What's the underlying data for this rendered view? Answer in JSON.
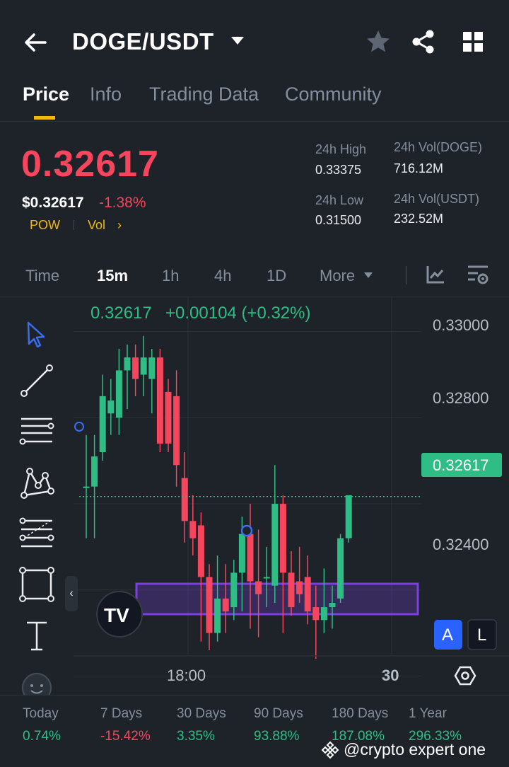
{
  "header": {
    "pair": "DOGE/USDT"
  },
  "tabs": [
    "Price",
    "Info",
    "Trading Data",
    "Community"
  ],
  "price": {
    "last": "0.32617",
    "usd": "$0.32617",
    "change_pct": "-1.38%",
    "tags": [
      "POW",
      "Vol"
    ],
    "stats": {
      "high_label": "24h High",
      "high_value": "0.33375",
      "low_label": "24h Low",
      "low_value": "0.31500",
      "vol_doge_label": "24h Vol(DOGE)",
      "vol_doge_value": "716.12M",
      "vol_usdt_label": "24h Vol(USDT)",
      "vol_usdt_value": "232.52M"
    }
  },
  "timeframes": {
    "items": [
      "Time",
      "15m",
      "1h",
      "4h",
      "1D",
      "More"
    ],
    "selected": "15m"
  },
  "chart": {
    "info_price": "0.32617",
    "info_change": "+0.00104 (+0.32%)",
    "current_price_label": "0.32617",
    "y_ticks": [
      "0.33000",
      "0.32800",
      "0.32400"
    ],
    "x_ticks": [
      "18:00",
      "30"
    ],
    "scale_buttons": [
      "A",
      "L"
    ],
    "logo_text": "TV",
    "colors": {
      "up": "#2ebd85",
      "down": "#f6465d",
      "box": "#7b3fe4"
    }
  },
  "chart_data": {
    "type": "candlestick",
    "y_range": [
      0.3225,
      0.3308
    ],
    "candles": [
      {
        "o": 0.3264,
        "h": 0.3276,
        "l": 0.3252,
        "c": 0.3264
      },
      {
        "o": 0.3264,
        "h": 0.3276,
        "l": 0.3252,
        "c": 0.3271
      },
      {
        "o": 0.3272,
        "h": 0.329,
        "l": 0.327,
        "c": 0.3285
      },
      {
        "o": 0.3281,
        "h": 0.3289,
        "l": 0.3276,
        "c": 0.3284
      },
      {
        "o": 0.328,
        "h": 0.3296,
        "l": 0.3276,
        "c": 0.3291
      },
      {
        "o": 0.3291,
        "h": 0.3297,
        "l": 0.3282,
        "c": 0.3294
      },
      {
        "o": 0.3294,
        "h": 0.3297,
        "l": 0.3285,
        "c": 0.3289
      },
      {
        "o": 0.329,
        "h": 0.3299,
        "l": 0.3285,
        "c": 0.3294
      },
      {
        "o": 0.3289,
        "h": 0.3296,
        "l": 0.3281,
        "c": 0.3294
      },
      {
        "o": 0.3294,
        "h": 0.3296,
        "l": 0.3272,
        "c": 0.3274
      },
      {
        "o": 0.3286,
        "h": 0.3289,
        "l": 0.3272,
        "c": 0.3274
      },
      {
        "o": 0.3285,
        "h": 0.3291,
        "l": 0.3264,
        "c": 0.3269
      },
      {
        "o": 0.3266,
        "h": 0.3272,
        "l": 0.3251,
        "c": 0.3256
      },
      {
        "o": 0.3256,
        "h": 0.3262,
        "l": 0.3248,
        "c": 0.3252
      },
      {
        "o": 0.3255,
        "h": 0.3258,
        "l": 0.3228,
        "c": 0.3243
      },
      {
        "o": 0.3243,
        "h": 0.3246,
        "l": 0.3226,
        "c": 0.323
      },
      {
        "o": 0.323,
        "h": 0.3248,
        "l": 0.3228,
        "c": 0.3238
      },
      {
        "o": 0.3238,
        "h": 0.3246,
        "l": 0.323,
        "c": 0.3235
      },
      {
        "o": 0.3236,
        "h": 0.3247,
        "l": 0.3233,
        "c": 0.3244
      },
      {
        "o": 0.3244,
        "h": 0.3257,
        "l": 0.3235,
        "c": 0.3253
      },
      {
        "o": 0.3253,
        "h": 0.326,
        "l": 0.3231,
        "c": 0.3242
      },
      {
        "o": 0.3242,
        "h": 0.3254,
        "l": 0.3229,
        "c": 0.3239
      },
      {
        "o": 0.3243,
        "h": 0.325,
        "l": 0.3236,
        "c": 0.3243
      },
      {
        "o": 0.3241,
        "h": 0.3269,
        "l": 0.3237,
        "c": 0.326
      },
      {
        "o": 0.326,
        "h": 0.3262,
        "l": 0.323,
        "c": 0.3244
      },
      {
        "o": 0.3244,
        "h": 0.3249,
        "l": 0.3234,
        "c": 0.3236
      },
      {
        "o": 0.3242,
        "h": 0.325,
        "l": 0.3237,
        "c": 0.3239
      },
      {
        "o": 0.3243,
        "h": 0.3248,
        "l": 0.3232,
        "c": 0.3235
      },
      {
        "o": 0.3236,
        "h": 0.3241,
        "l": 0.3224,
        "c": 0.3233
      },
      {
        "o": 0.3233,
        "h": 0.3245,
        "l": 0.323,
        "c": 0.3236
      },
      {
        "o": 0.3236,
        "h": 0.3241,
        "l": 0.3231,
        "c": 0.3237
      },
      {
        "o": 0.3238,
        "h": 0.3253,
        "l": 0.3237,
        "c": 0.3252
      },
      {
        "o": 0.3252,
        "h": 0.3262,
        "l": 0.3251,
        "c": 0.3262
      }
    ]
  },
  "performance": [
    {
      "label": "Today",
      "value": "0.74%",
      "color": "#2ebd85"
    },
    {
      "label": "7 Days",
      "value": "-15.42%",
      "color": "#f6465d"
    },
    {
      "label": "30 Days",
      "value": "3.35%",
      "color": "#2ebd85"
    },
    {
      "label": "90 Days",
      "value": "93.88%",
      "color": "#2ebd85"
    },
    {
      "label": "180 Days",
      "value": "187.08%",
      "color": "#2ebd85"
    },
    {
      "label": "1 Year",
      "value": "296.33%",
      "color": "#2ebd85"
    }
  ],
  "watermark": "@crypto expert one"
}
